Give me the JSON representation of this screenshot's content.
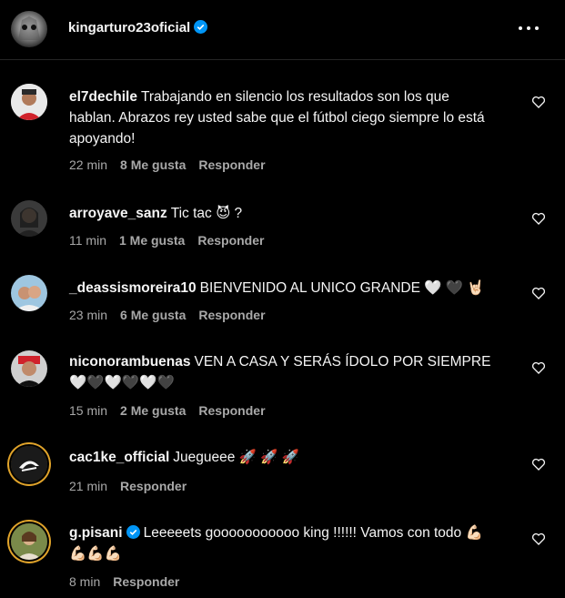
{
  "header": {
    "username": "kingarturo23oficial"
  },
  "comments": [
    {
      "user": "el7dechile",
      "text": "Trabajando en silencio los resultados son los que hablan. Abrazos rey usted sabe que el fútbol ciego siempre lo está apoyando!",
      "time": "22 min",
      "likes": "8 Me gusta",
      "reply": "Responder"
    },
    {
      "user": "arroyave_sanz",
      "text": "Tic tac 😈 ?",
      "time": "11 min",
      "likes": "1 Me gusta",
      "reply": "Responder"
    },
    {
      "user": "_deassismoreira10",
      "text": "BIENVENIDO AL UNICO GRANDE 🤍 🖤 🤘🏻",
      "time": "23 min",
      "likes": "6 Me gusta",
      "reply": "Responder"
    },
    {
      "user": "niconorambuenas",
      "text": "VEN A CASA Y SERÁS ÍDOLO POR SIEMPRE 🤍🖤🤍🖤🤍🖤",
      "time": "15 min",
      "likes": "2 Me gusta",
      "reply": "Responder"
    },
    {
      "user": "cac1ke_official",
      "text": "Juegueee 🚀 🚀 🚀",
      "time": "21 min",
      "reply": "Responder"
    },
    {
      "user": "g.pisani",
      "text": "Leeeeets gooooooooooo king !!!!!! Vamos con todo 💪🏻💪🏻💪🏻💪🏻",
      "time": "8 min",
      "reply": "Responder"
    }
  ],
  "colors": {
    "background": "#000000",
    "text": "#f5f5f5",
    "secondary": "#a8a8a8",
    "verified": "#0095f6",
    "story_ring": "#e0a32a"
  },
  "icons": [
    "more-icon",
    "heart-icon",
    "verified-icon"
  ]
}
